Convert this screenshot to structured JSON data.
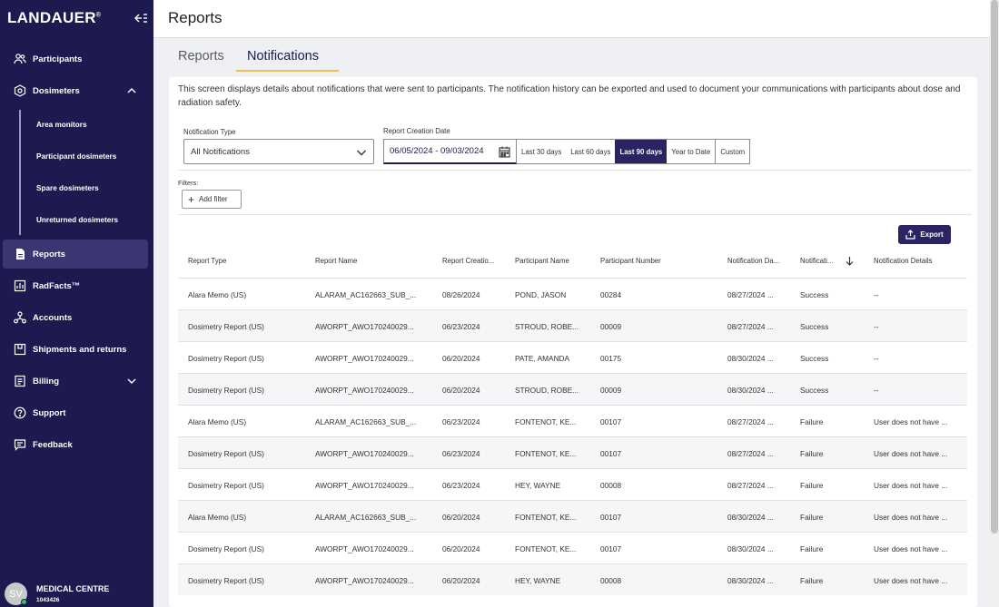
{
  "brand": {
    "name": "LANDAUER",
    "mark": "®"
  },
  "sidebar": {
    "items": [
      {
        "label": "Participants",
        "icon": "people-icon"
      },
      {
        "label": "Dosimeters",
        "icon": "dosimeter-icon"
      },
      {
        "label": "Reports",
        "icon": "report-icon"
      },
      {
        "label": "RadFacts™",
        "icon": "chart-icon"
      },
      {
        "label": "Accounts",
        "icon": "accounts-icon"
      },
      {
        "label": "Shipments and returns",
        "icon": "box-icon"
      },
      {
        "label": "Billing",
        "icon": "billing-icon"
      },
      {
        "label": "Support",
        "icon": "help-icon"
      },
      {
        "label": "Feedback",
        "icon": "feedback-icon"
      }
    ],
    "dosimeter_sub": [
      "Area monitors",
      "Participant dosimeters",
      "Spare dosimeters",
      "Unreturned dosimeters"
    ],
    "user": {
      "initials": "SV",
      "name": "MEDICAL CENTRE",
      "id": "1043426"
    }
  },
  "header": {
    "title": "Reports"
  },
  "tabs": [
    {
      "label": "Reports"
    },
    {
      "label": "Notifications"
    }
  ],
  "description": "This screen displays details about notifications that were sent to participants. The notification history can be exported and used to document your communications with participants about dose and radiation safety.",
  "filters": {
    "type_label": "Notification Type",
    "type_value": "All Notifications",
    "date_label": "Report Creation Date",
    "date_value": "06/05/2024 - 09/03/2024",
    "ranges": [
      "Last 30 days",
      "Last 60 days",
      "Last 90 days",
      "Year to Date",
      "Custom"
    ],
    "active_range": "Last 90 days",
    "filters_label": "Filters:",
    "add_filter": "Add filter"
  },
  "export_label": "Export",
  "table": {
    "columns": [
      "Report Type",
      "Report Name",
      "Report Creatio...",
      "Participant Name",
      "Participant Number",
      "Notification Da...",
      "Notificati...",
      "Notification Details"
    ],
    "rows": [
      [
        "Alara Memo (US)",
        "ALARAM_AC162663_SUB_...",
        "08/26/2024",
        "POND, JASON",
        "00284",
        "08/27/2024 ...",
        "Success",
        "--"
      ],
      [
        "Dosimetry Report (US)",
        "AWORPT_AWO170240029...",
        "06/23/2024",
        "STROUD, ROBE...",
        "00009",
        "08/27/2024 ...",
        "Success",
        "--"
      ],
      [
        "Dosimetry Report (US)",
        "AWORPT_AWO170240029...",
        "06/20/2024",
        "PATE, AMANDA",
        "00175",
        "08/30/2024 ...",
        "Success",
        "--"
      ],
      [
        "Dosimetry Report (US)",
        "AWORPT_AWO170240029...",
        "06/20/2024",
        "STROUD, ROBE...",
        "00009",
        "08/30/2024 ...",
        "Success",
        "--"
      ],
      [
        "Alara Memo (US)",
        "ALARAM_AC162663_SUB_...",
        "06/23/2024",
        "FONTENOT, KE...",
        "00107",
        "08/27/2024 ...",
        "Failure",
        "User does not have ..."
      ],
      [
        "Dosimetry Report (US)",
        "AWORPT_AWO170240029...",
        "06/23/2024",
        "FONTENOT, KE...",
        "00107",
        "08/27/2024 ...",
        "Failure",
        "User does not have ..."
      ],
      [
        "Dosimetry Report (US)",
        "AWORPT_AWO170240029...",
        "06/23/2024",
        "HEY, WAYNE",
        "00008",
        "08/27/2024 ...",
        "Failure",
        "User does not have ..."
      ],
      [
        "Alara Memo (US)",
        "ALARAM_AC162663_SUB_...",
        "06/20/2024",
        "FONTENOT, KE...",
        "00107",
        "08/30/2024 ...",
        "Failure",
        "User does not have ..."
      ],
      [
        "Dosimetry Report (US)",
        "AWORPT_AWO170240029...",
        "06/20/2024",
        "FONTENOT, KE...",
        "00107",
        "08/30/2024 ...",
        "Failure",
        "User does not have ..."
      ],
      [
        "Dosimetry Report (US)",
        "AWORPT_AWO170240029...",
        "06/20/2024",
        "HEY, WAYNE",
        "00008",
        "08/30/2024 ...",
        "Failure",
        "User does not have ..."
      ]
    ]
  }
}
